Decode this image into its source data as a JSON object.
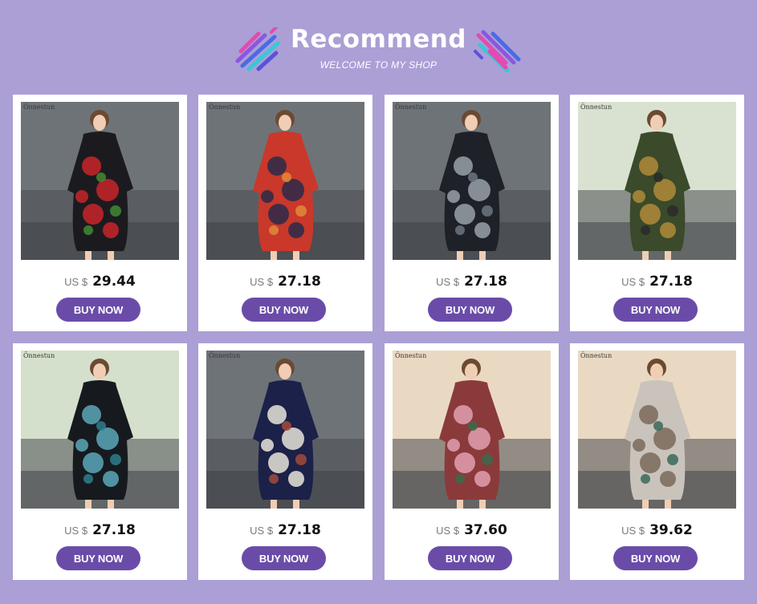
{
  "header": {
    "title": "Recommend",
    "subtitle": "WELCOME TO MY SHOP",
    "decor_icon": "sparkle-lines-icon"
  },
  "colors": {
    "background": "#ab9fd6",
    "button": "#6a4ca8",
    "card": "#ffffff"
  },
  "products": [
    {
      "brand": "Önnestun",
      "currency": "US $",
      "price": "29.44",
      "button": "BUY NOW",
      "dress_color": "#1b1b1f",
      "pattern_color": "#c8242a",
      "accent_color": "#3f8a33",
      "backdrop": "#6e7378"
    },
    {
      "brand": "Önnestun",
      "currency": "US $",
      "price": "27.18",
      "button": "BUY NOW",
      "dress_color": "#c9382a",
      "pattern_color": "#2a2a4a",
      "accent_color": "#e08a3a",
      "backdrop": "#6e7378"
    },
    {
      "brand": "Önnestun",
      "currency": "US $",
      "price": "27.18",
      "button": "BUY NOW",
      "dress_color": "#1e2128",
      "pattern_color": "#9aa0a8",
      "accent_color": "#6c7480",
      "backdrop": "#6e7378"
    },
    {
      "brand": "Önnestun",
      "currency": "US $",
      "price": "27.18",
      "button": "BUY NOW",
      "dress_color": "#3a4a2a",
      "pattern_color": "#b08a3a",
      "accent_color": "#2a2a2a",
      "backdrop": "#d9e2d0"
    },
    {
      "brand": "Önnestun",
      "currency": "US $",
      "price": "27.18",
      "button": "BUY NOW",
      "dress_color": "#161a1e",
      "pattern_color": "#5aa8b8",
      "accent_color": "#2e7e8e",
      "backdrop": "#d4e0cc"
    },
    {
      "brand": "Önnestun",
      "currency": "US $",
      "price": "27.18",
      "button": "BUY NOW",
      "dress_color": "#1b2148",
      "pattern_color": "#e8e4da",
      "accent_color": "#a24a3a",
      "backdrop": "#6e7378"
    },
    {
      "brand": "Önnestun",
      "currency": "US $",
      "price": "37.60",
      "button": "BUY NOW",
      "dress_color": "#8a3a3a",
      "pattern_color": "#e0a0b0",
      "accent_color": "#3a6a4a",
      "backdrop": "#ead9c2"
    },
    {
      "brand": "Önnestun",
      "currency": "US $",
      "price": "39.62",
      "button": "BUY NOW",
      "dress_color": "#c9c3bc",
      "pattern_color": "#7a6a5a",
      "accent_color": "#3a6a5a",
      "backdrop": "#ead9c2"
    }
  ]
}
